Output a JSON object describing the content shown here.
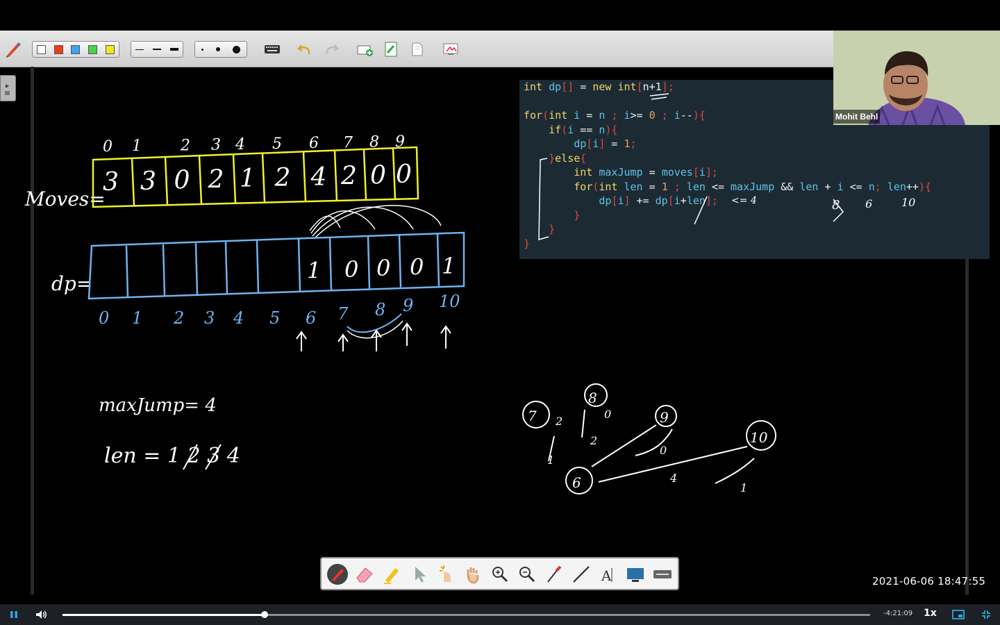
{
  "toolbar": {
    "colors": [
      "#ffffff",
      "#ef3b1d",
      "#3aa6f0",
      "#4ad14a",
      "#f2e81c"
    ],
    "line_widths": [
      "thin",
      "medium",
      "thick"
    ],
    "dot_sizes": [
      "small",
      "medium",
      "large"
    ],
    "icons": [
      "keyboard-icon",
      "undo-icon",
      "redo-icon",
      "new-page-icon",
      "export-icon",
      "page-icon",
      "screen-capture-icon"
    ]
  },
  "webcam": {
    "name": "Mohit Behl"
  },
  "code": {
    "lines": [
      [
        [
          "kw",
          "int "
        ],
        [
          "var",
          "dp"
        ],
        [
          "br",
          "[]"
        ],
        [
          "op",
          " = "
        ],
        [
          "kw",
          "new int"
        ],
        [
          "br",
          "["
        ],
        [
          "op",
          "n+1"
        ],
        [
          "br",
          "];"
        ]
      ],
      [],
      [
        [
          "kw",
          "for"
        ],
        [
          "br",
          "("
        ],
        [
          "kw",
          "int "
        ],
        [
          "var",
          "i"
        ],
        [
          "op",
          " = "
        ],
        [
          "var",
          "n"
        ],
        [
          "br",
          " ; "
        ],
        [
          "var",
          "i"
        ],
        [
          "op",
          ">= "
        ],
        [
          "num",
          "0"
        ],
        [
          "br",
          " ; "
        ],
        [
          "var",
          "i"
        ],
        [
          "op",
          "--"
        ],
        [
          "br",
          "){"
        ]
      ],
      [
        [
          "op",
          "    "
        ],
        [
          "kw",
          "if"
        ],
        [
          "br",
          "("
        ],
        [
          "var",
          "i"
        ],
        [
          "op",
          " == "
        ],
        [
          "var",
          "n"
        ],
        [
          "br",
          "){"
        ]
      ],
      [
        [
          "op",
          "        "
        ],
        [
          "var",
          "dp"
        ],
        [
          "br",
          "["
        ],
        [
          "var",
          "i"
        ],
        [
          "br",
          "]"
        ],
        [
          "op",
          " = "
        ],
        [
          "num",
          "1"
        ],
        [
          "br",
          ";"
        ]
      ],
      [
        [
          "op",
          "    "
        ],
        [
          "br",
          "}"
        ],
        [
          "kw",
          "else"
        ],
        [
          "br",
          "{"
        ]
      ],
      [
        [
          "op",
          "        "
        ],
        [
          "kw",
          "int "
        ],
        [
          "var",
          "maxJump"
        ],
        [
          "op",
          " = "
        ],
        [
          "var",
          "moves"
        ],
        [
          "br",
          "["
        ],
        [
          "var",
          "i"
        ],
        [
          "br",
          "];"
        ]
      ],
      [
        [
          "op",
          "        "
        ],
        [
          "kw",
          "for"
        ],
        [
          "br",
          "("
        ],
        [
          "kw",
          "int "
        ],
        [
          "var",
          "len"
        ],
        [
          "op",
          " = "
        ],
        [
          "num",
          "1"
        ],
        [
          "br",
          " ; "
        ],
        [
          "var",
          "len"
        ],
        [
          "op",
          " <= "
        ],
        [
          "var",
          "maxJump"
        ],
        [
          "op",
          " && "
        ],
        [
          "var",
          "len"
        ],
        [
          "op",
          " + "
        ],
        [
          "var",
          "i"
        ],
        [
          "op",
          " <= "
        ],
        [
          "var",
          "n"
        ],
        [
          "br",
          "; "
        ],
        [
          "var",
          "len"
        ],
        [
          "op",
          "++"
        ],
        [
          "br",
          "){"
        ]
      ],
      [
        [
          "op",
          "            "
        ],
        [
          "var",
          "dp"
        ],
        [
          "br",
          "["
        ],
        [
          "var",
          "i"
        ],
        [
          "br",
          "]"
        ],
        [
          "op",
          " += "
        ],
        [
          "var",
          "dp"
        ],
        [
          "br",
          "["
        ],
        [
          "var",
          "i"
        ],
        [
          "op",
          "+"
        ],
        [
          "var",
          "len"
        ],
        [
          "br",
          "];"
        ]
      ],
      [
        [
          "op",
          "        "
        ],
        [
          "br",
          "}"
        ]
      ],
      [
        [
          "op",
          "    "
        ],
        [
          "br",
          "}"
        ]
      ],
      [
        [
          "br",
          "}"
        ]
      ]
    ]
  },
  "board": {
    "moves_label": "Moves=",
    "moves_indices": [
      "0",
      "1",
      "2",
      "3",
      "4",
      "5",
      "6",
      "7",
      "8",
      "9"
    ],
    "moves_values": [
      "3",
      "3",
      "0",
      "2",
      "1",
      "2",
      "4",
      "2",
      "0",
      "0"
    ],
    "dp_label": "dp=",
    "dp_values": [
      "",
      "",
      "",
      "",
      "",
      "",
      "1",
      "0",
      "0",
      "0",
      "1"
    ],
    "dp_indices": [
      "0",
      "1",
      "2",
      "3",
      "4",
      "5",
      "6",
      "7",
      "8",
      "9",
      "10"
    ],
    "maxjump_text": "maxJump= 4",
    "len_text": "len = 1 2 3 4",
    "graph_nodes": [
      "7",
      "8",
      "9",
      "10",
      "6"
    ],
    "graph_edge_labels": [
      "2",
      "2",
      "0",
      "4",
      "1",
      "0",
      "1"
    ],
    "code_annotations": [
      "<= 4",
      "8",
      "6",
      "10"
    ]
  },
  "palette": {
    "tools": [
      "pen-tool-icon",
      "eraser-icon",
      "highlighter-icon",
      "pointer-icon",
      "magic-hand-icon",
      "hand-icon",
      "zoom-in-icon",
      "zoom-out-icon",
      "brush-icon",
      "line-icon",
      "text-icon",
      "screen-icon",
      "keyboard-icon"
    ]
  },
  "timestamp": "2021-06-06  18:47:55",
  "player": {
    "time_remaining": "-4:21:09",
    "speed": "1x",
    "progress": 0.25
  }
}
